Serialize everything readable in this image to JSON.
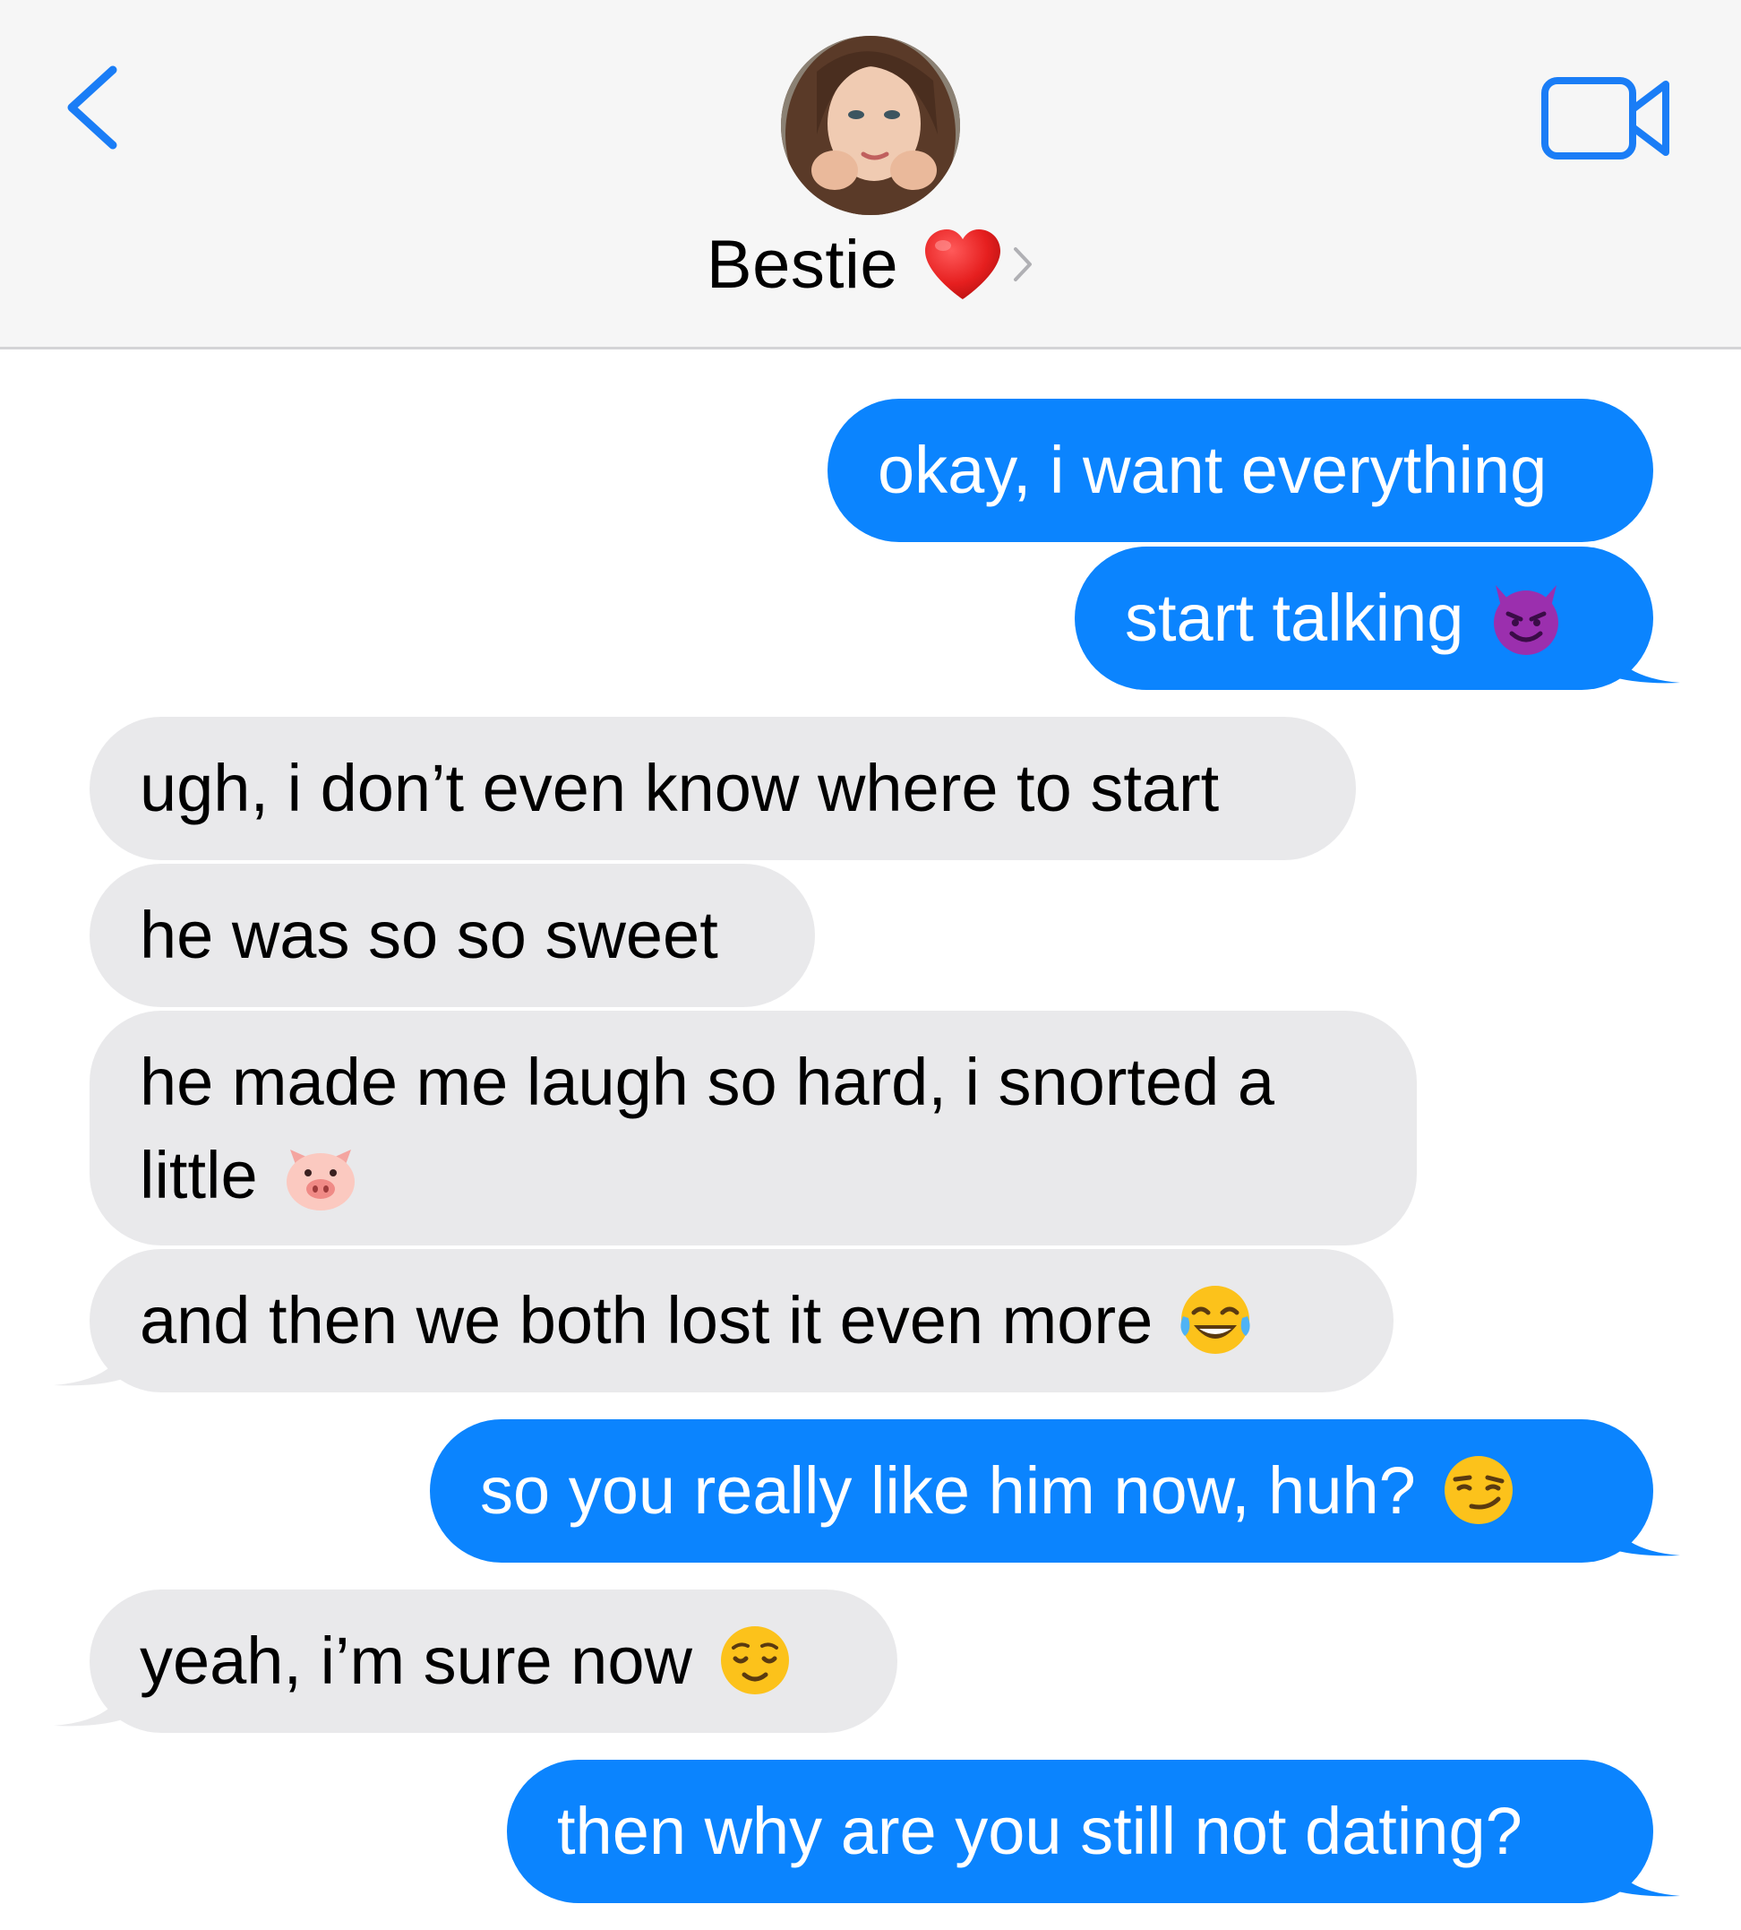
{
  "header": {
    "contact_name": "Bestie",
    "contact_emoji": "heart-icon",
    "back_icon": "chevron-left-icon",
    "video_icon": "video-camera-icon"
  },
  "colors": {
    "sent_bubble": "#0b84fe",
    "received_bubble": "#e9e9eb",
    "accent": "#1a7df6"
  },
  "messages": [
    {
      "from": "me",
      "text": "okay, i want everything"
    },
    {
      "from": "me",
      "text": "start talking",
      "emoji": "smiling-devil-icon"
    },
    {
      "from": "them",
      "text": "ugh, i don’t even know where to start"
    },
    {
      "from": "them",
      "text": "he was so so sweet"
    },
    {
      "from": "them",
      "text": "he made me laugh so hard, i snorted a",
      "text_line2": "little",
      "emoji": "pig-face-icon"
    },
    {
      "from": "them",
      "text": "and then we both lost it even more",
      "emoji": "tears-of-joy-icon"
    },
    {
      "from": "me",
      "text": "so you really like him now, huh?",
      "emoji": "smirking-face-icon"
    },
    {
      "from": "them",
      "text": "yeah, i’m sure now",
      "emoji": "relieved-face-icon"
    },
    {
      "from": "me",
      "text": "then why are you still not dating?"
    }
  ]
}
